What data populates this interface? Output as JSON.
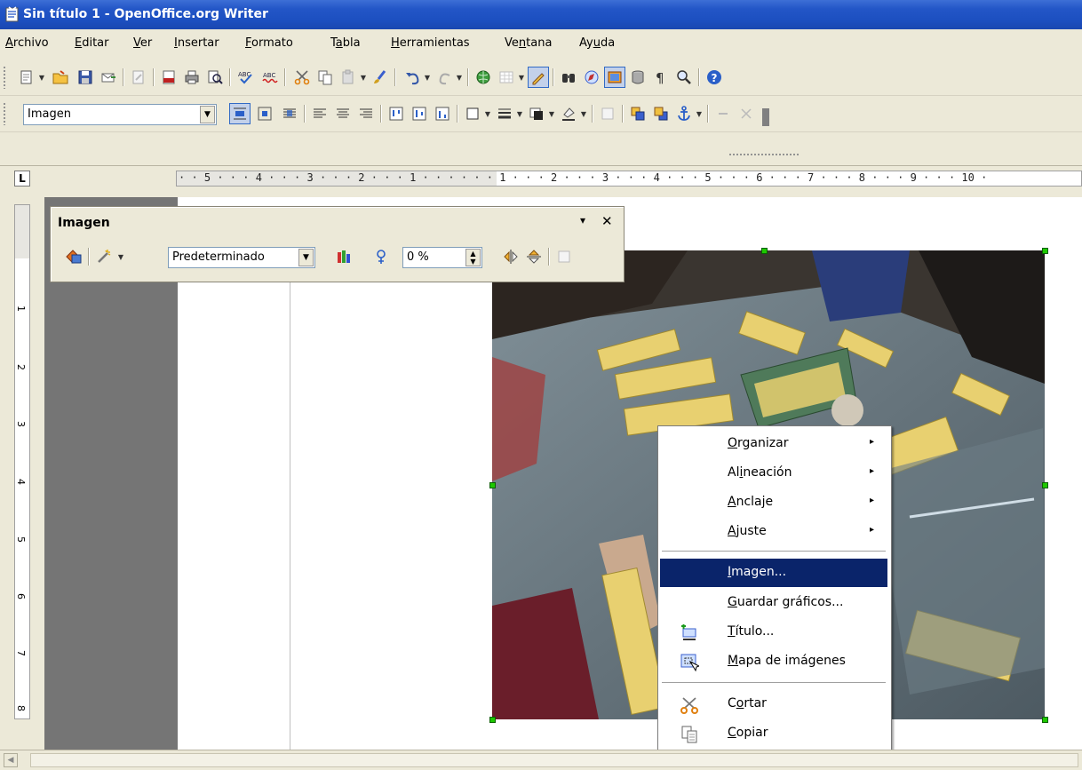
{
  "window": {
    "title": "Sin título 1 - OpenOffice.org Writer"
  },
  "menubar": [
    {
      "pre": "",
      "u": "A",
      "post": "rchivo"
    },
    {
      "pre": "",
      "u": "E",
      "post": "ditar"
    },
    {
      "pre": "",
      "u": "V",
      "post": "er"
    },
    {
      "pre": "",
      "u": "I",
      "post": "nsertar"
    },
    {
      "pre": "",
      "u": "F",
      "post": "ormato"
    },
    {
      "pre": "T",
      "u": "a",
      "post": "bla"
    },
    {
      "pre": "",
      "u": "H",
      "post": "erramientas"
    },
    {
      "pre": "Ve",
      "u": "n",
      "post": "tana"
    },
    {
      "pre": "Ay",
      "u": "u",
      "post": "da"
    }
  ],
  "frame_toolbar": {
    "style_value": "Imagen"
  },
  "ruler": {
    "horizontal_text": "· · 5 · · · 4 · · · 3 · · · 2 · · · 1 · · ·   · · · 1 · · · 2 · · · 3 · · · 4 · · · 5 · · · 6 · · · 7 · · · 8 · · · 9 · · · 10 ·",
    "vertical_labels": [
      "1",
      "2",
      "3",
      "4",
      "5",
      "6",
      "7",
      "8"
    ],
    "tab_stop": "L"
  },
  "image_toolbar": {
    "title": "Imagen",
    "filter_mode": "Predeterminado",
    "transparency": "0 %",
    "menu_glyph": "▾",
    "close_glyph": "✕"
  },
  "context_menu": {
    "items": [
      {
        "pre": "",
        "u": "O",
        "post": "rganizar",
        "submenu": "▸"
      },
      {
        "pre": "Al",
        "u": "i",
        "post": "neación",
        "submenu": "▸"
      },
      {
        "pre": "",
        "u": "A",
        "post": "nclaje",
        "submenu": "▸"
      },
      {
        "pre": "",
        "u": "A",
        "post": "juste",
        "submenu": "▸"
      },
      {
        "pre": "",
        "u": "I",
        "post": "magen...",
        "submenu": ""
      },
      {
        "pre": "",
        "u": "G",
        "post": "uardar gráficos...",
        "submenu": ""
      },
      {
        "pre": "",
        "u": "T",
        "post": "ítulo...",
        "submenu": ""
      },
      {
        "pre": "",
        "u": "M",
        "post": "apa de imágenes",
        "submenu": ""
      },
      {
        "pre": "C",
        "u": "o",
        "post": "rtar",
        "submenu": ""
      },
      {
        "pre": "",
        "u": "C",
        "post": "opiar",
        "submenu": ""
      }
    ]
  },
  "colors": {
    "titlebar": "#2356c7",
    "selection": "#0a246a",
    "handle": "#1ec800",
    "chrome": "#ece9d8"
  }
}
